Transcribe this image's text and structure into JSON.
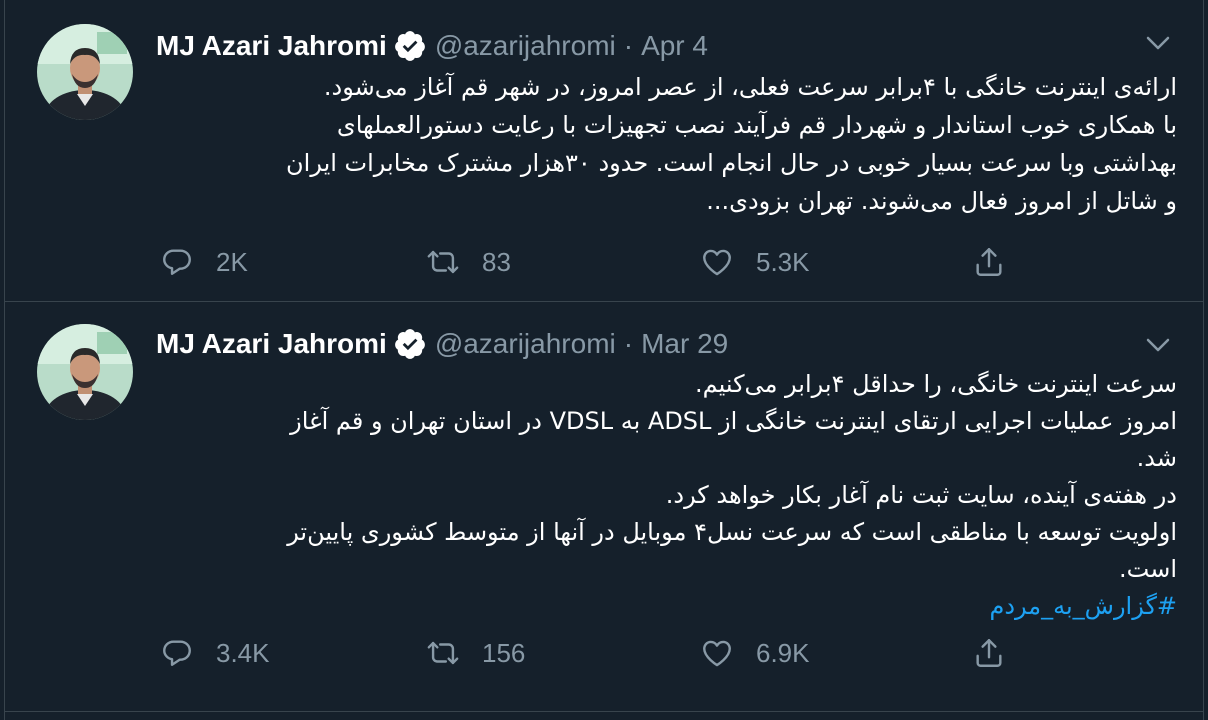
{
  "colors": {
    "background": "#15202b",
    "border": "#38444d",
    "text_primary": "#ffffff",
    "text_secondary": "#8899a6",
    "accent": "#1da1f2"
  },
  "tweets": [
    {
      "author_name": "MJ Azari Jahromi",
      "verified": true,
      "handle": "@azarijahromi",
      "separator": "·",
      "date": "Apr 4",
      "lines": [
        "ارائه‌ی اینترنت خانگی با ۴برابر سرعت فعلی، از عصر امروز، در شهر قم آغاز می‌شود.",
        "با همکاری خوب استاندار و شهردار قم فرآیند نصب تجهیزات با رعایت دستورالعملهای",
        "بهداشتی وبا سرعت بسیار خوبی در حال انجام است. حدود ۳۰هزار مشترک مخابرات ایران",
        "و شاتل از امروز فعال می‌شوند. تهران بزودی..."
      ],
      "hashtag": "",
      "reply_count": "2K",
      "retweet_count": "83",
      "like_count": "5.3K",
      "icons": [
        "reply-icon",
        "retweet-icon",
        "like-icon",
        "share-icon",
        "chevron-down-icon",
        "verified-badge-icon"
      ]
    },
    {
      "author_name": "MJ Azari Jahromi",
      "verified": true,
      "handle": "@azarijahromi",
      "separator": "·",
      "date": "Mar 29",
      "lines": [
        "سرعت اینترنت خانگی، را حداقل ۴برابر می‌کنیم.",
        "امروز عملیات اجرایی ارتقای اینترنت خانگی از ADSL به VDSL در استان تهران و قم آغاز",
        "شد.",
        "در هفته‌ی آینده، سایت ثبت نام آغار بکار خواهد کرد.",
        "اولویت توسعه با مناطقی است که سرعت نسل۴ موبایل در آنها از متوسط کشوری پایین‌تر",
        "است."
      ],
      "hashtag": "#گزارش_به_مردم",
      "reply_count": "3.4K",
      "retweet_count": "156",
      "like_count": "6.9K",
      "icons": [
        "reply-icon",
        "retweet-icon",
        "like-icon",
        "share-icon",
        "chevron-down-icon",
        "verified-badge-icon"
      ]
    }
  ]
}
